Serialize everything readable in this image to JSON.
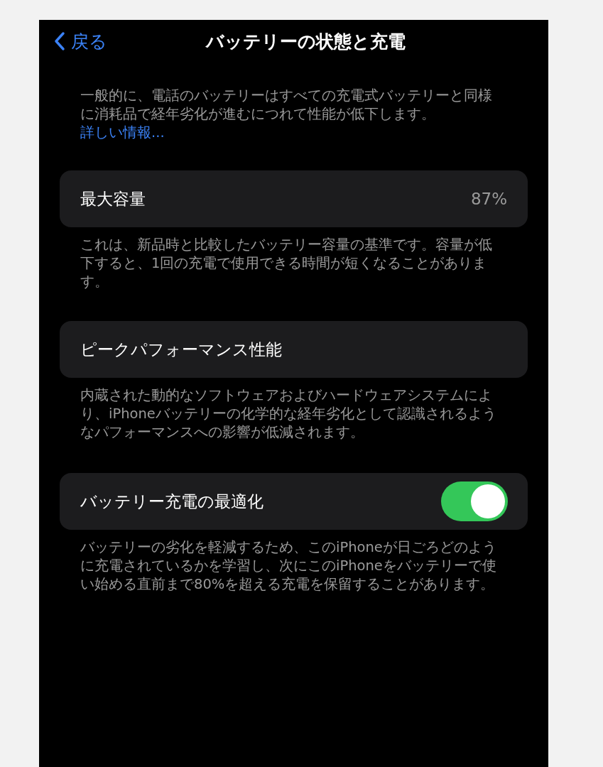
{
  "nav": {
    "back": "戻る",
    "title": "バッテリーの状態と充電"
  },
  "intro": {
    "text": "一般的に、電話のバッテリーはすべての充電式バッテリーと同様に消耗品で経年劣化が進むにつれて性能が低下します。",
    "link": "詳しい情報..."
  },
  "sections": [
    {
      "kind": "value",
      "label": "最大容量",
      "value": "87%",
      "footer": "これは、新品時と比較したバッテリー容量の基準です。容量が低下すると、1回の充電で使用できる時間が短くなることがあります。"
    },
    {
      "kind": "plain",
      "label": "ピークパフォーマンス性能",
      "footer": "内蔵された動的なソフトウェアおよびハードウェアシステムにより、iPhoneバッテリーの化学的な経年劣化として認識されるようなパフォーマンスへの影響が低減されます。"
    },
    {
      "kind": "toggle",
      "label": "バッテリー充電の最適化",
      "on": true,
      "footer": "バッテリーの劣化を軽減するため、このiPhoneが日ごろどのように充電されているかを学習し、次にこのiPhoneをバッテリーで使い始める直前まで80%を超える充電を保留することがあります。"
    }
  ]
}
